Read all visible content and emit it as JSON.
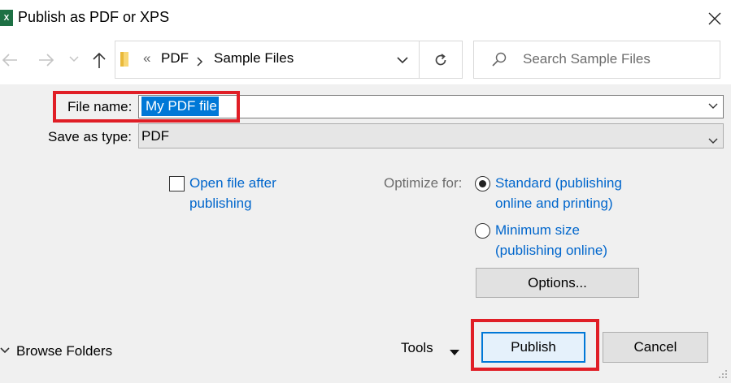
{
  "window": {
    "title": "Publish as PDF or XPS",
    "app_badge": "X"
  },
  "nav": {
    "breadcrumb_sep": "«",
    "crumbs": [
      "PDF",
      "Sample Files"
    ],
    "search_placeholder": "Search Sample Files"
  },
  "form": {
    "file_name_label": "File name:",
    "file_name_value": "My PDF file",
    "save_type_label": "Save as type:",
    "save_type_value": "PDF"
  },
  "options": {
    "open_after_line1": "Open file after",
    "open_after_line2": "publishing",
    "open_after_checked": false,
    "optimize_label": "Optimize for:",
    "standard_line1": "Standard (publishing",
    "standard_line2": "online and printing)",
    "standard_selected": true,
    "minimum_line1": "Minimum size",
    "minimum_line2": "(publishing online)",
    "minimum_selected": false,
    "options_button": "Options..."
  },
  "footer": {
    "browse_folders": "Browse Folders",
    "tools": "Tools",
    "publish": "Publish",
    "cancel": "Cancel"
  },
  "colors": {
    "accent": "#0078d7",
    "link": "#0066cc",
    "callout": "#e01e26",
    "excel_green": "#1d7044"
  }
}
